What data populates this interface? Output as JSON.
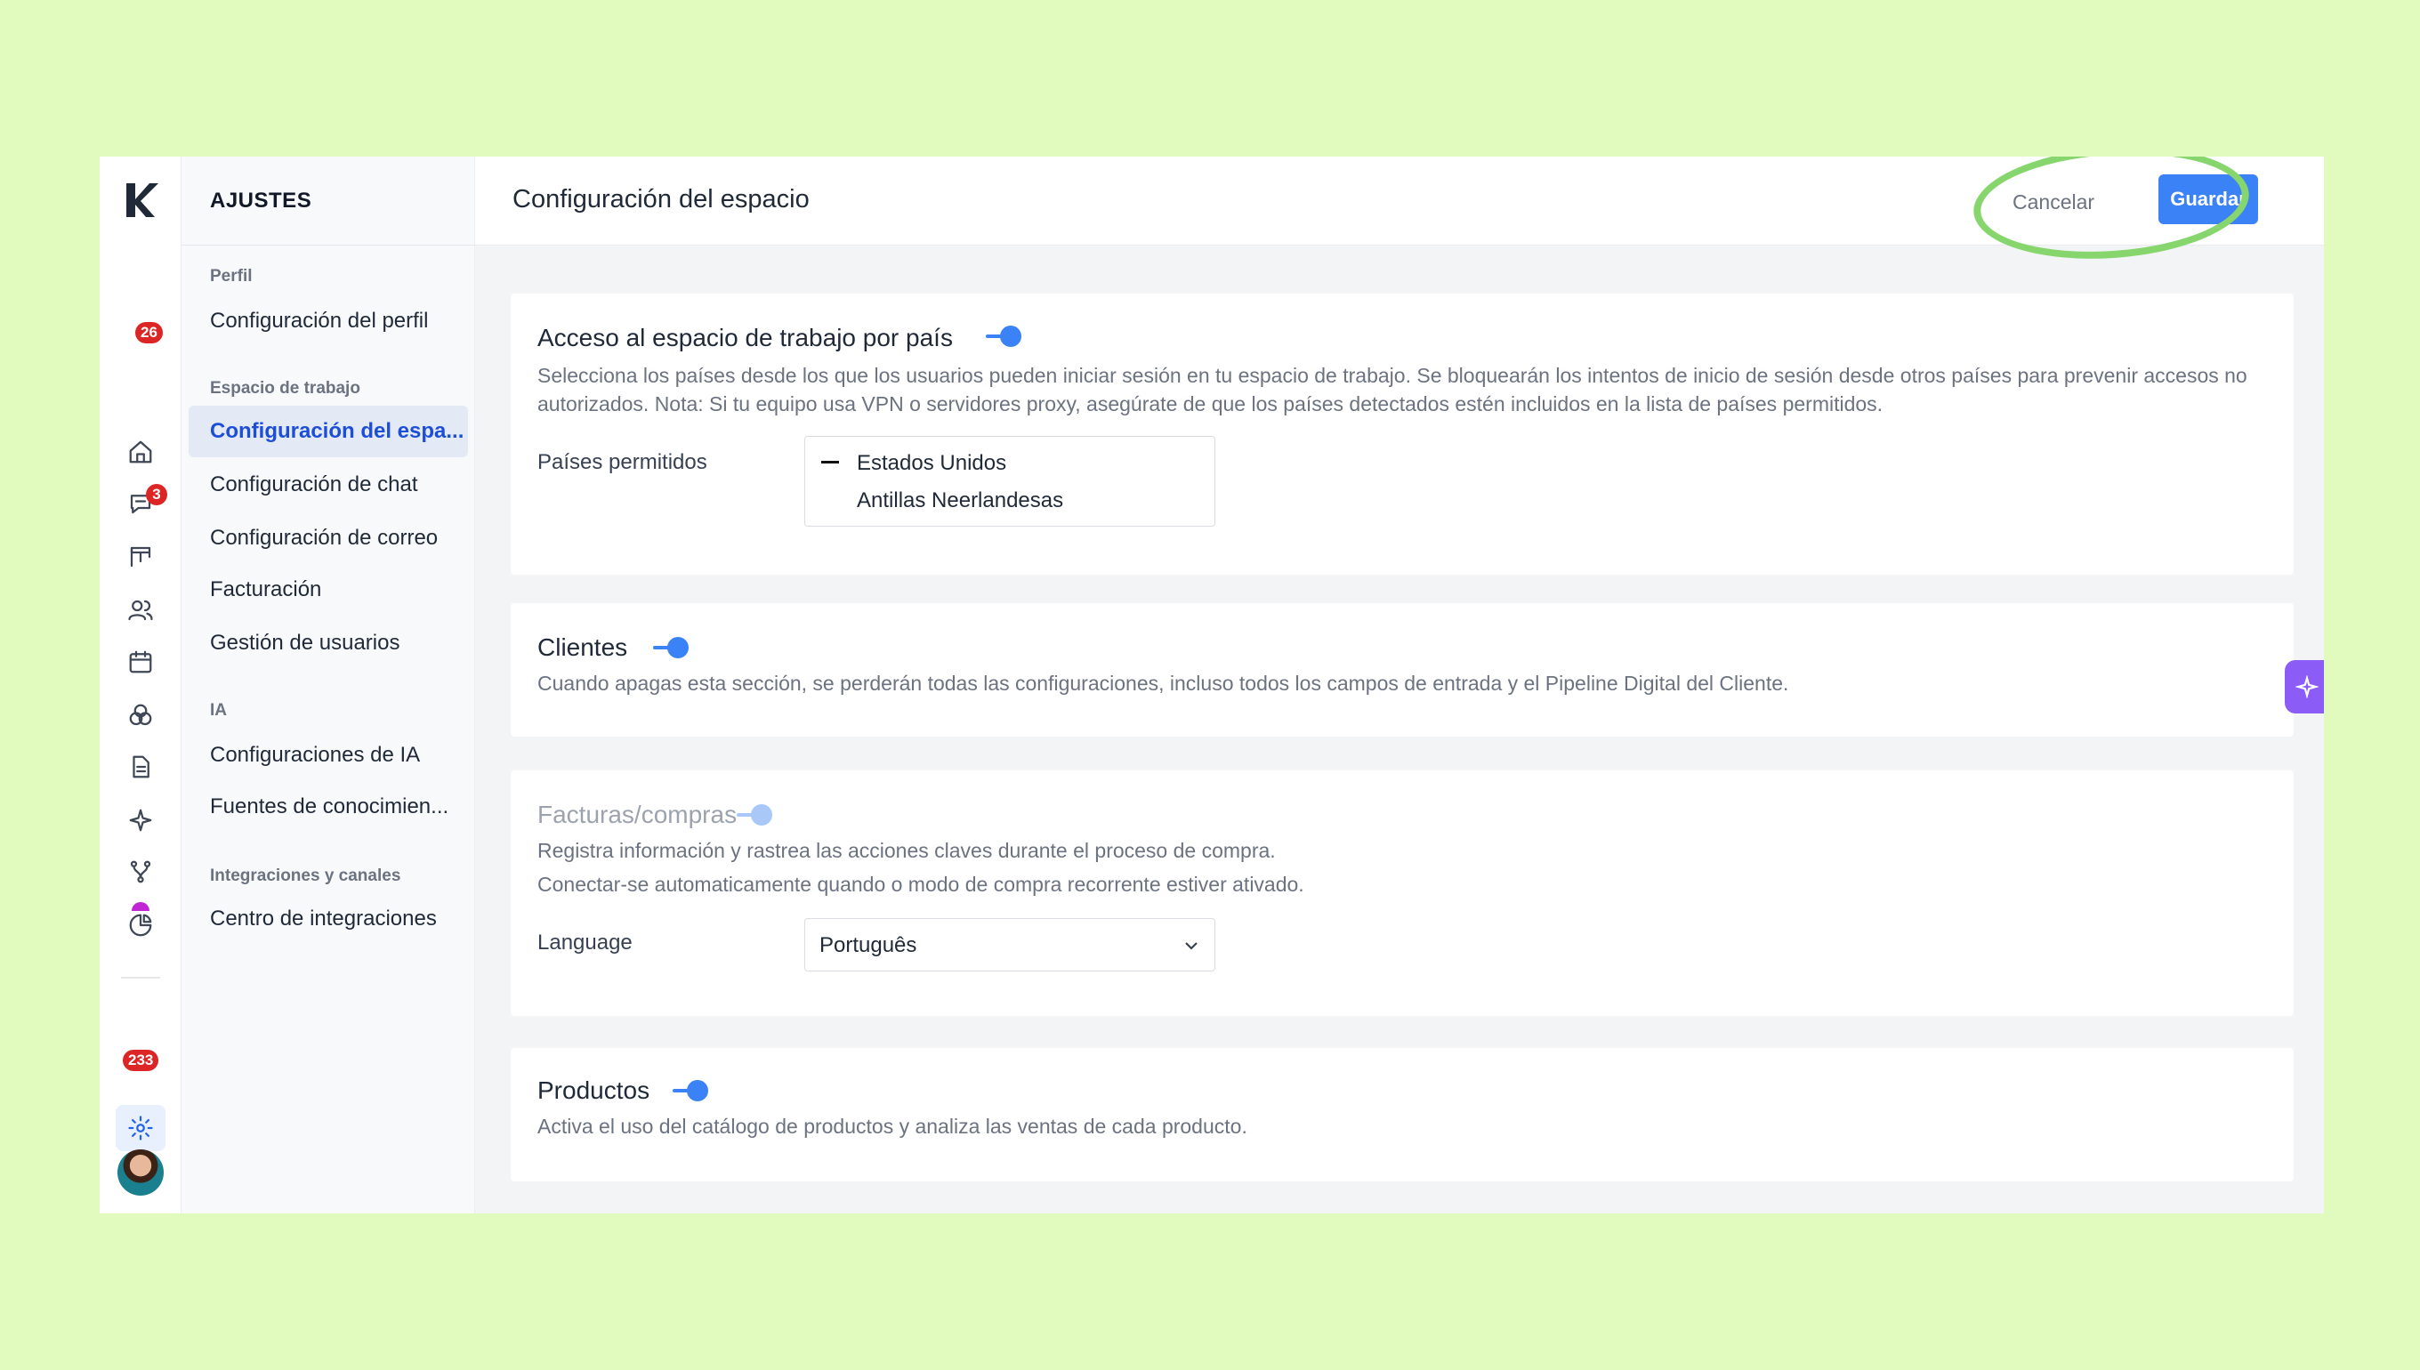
{
  "rail": {
    "badges": {
      "chat": "26",
      "calendar": "3",
      "notifications": "233"
    }
  },
  "settings_nav": {
    "header": "AJUSTES",
    "groups": [
      {
        "label": "Perfil",
        "items": [
          "Configuración del perfil"
        ]
      },
      {
        "label": "Espacio de trabajo",
        "items": [
          "Configuración del espa...",
          "Configuración de chat",
          "Configuración de correo",
          "Facturación",
          "Gestión de usuarios"
        ]
      },
      {
        "label": "IA",
        "items": [
          "Configuraciones de IA",
          "Fuentes de conocimien..."
        ]
      },
      {
        "label": "Integraciones y canales",
        "items": [
          "Centro de integraciones"
        ]
      }
    ],
    "active_item": "Configuración del espa..."
  },
  "topbar": {
    "title": "Configuración del espacio",
    "cancel_label": "Cancelar",
    "save_label": "Guardar"
  },
  "sections": {
    "country_access": {
      "title": "Acceso al espacio de trabajo por país",
      "enabled": true,
      "description": "Selecciona los países desde los que los usuarios pueden iniciar sesión en tu espacio de trabajo. Se bloquearán los intentos de inicio de sesión desde otros países para prevenir accesos no autorizados. Nota: Si tu equipo usa VPN o servidores proxy, asegúrate de que los países detectados estén incluidos en la lista de países permitidos.",
      "field_label": "Países permitidos",
      "countries": [
        "Estados Unidos",
        "Antillas Neerlandesas"
      ]
    },
    "clients": {
      "title": "Clientes",
      "enabled": true,
      "description": "Cuando apagas esta sección, se perderán todas las configuraciones, incluso todos los campos de entrada y el Pipeline Digital del Cliente."
    },
    "invoices": {
      "title": "Facturas/compras",
      "enabled": true,
      "disabled_look": true,
      "description_1": "Registra información y rastrea las acciones claves durante el proceso de compra.",
      "description_2": "Conectar-se automaticamente quando o modo de compra recorrente estiver ativado.",
      "field_label": "Language",
      "language_value": "Português"
    },
    "products": {
      "title": "Productos",
      "enabled": true,
      "description": "Activa el uso del catálogo de productos y analiza las ventas de cada producto."
    }
  },
  "colors": {
    "accent": "#3b82f6",
    "highlight": "#86d66d",
    "background": "#e0fbbd"
  }
}
